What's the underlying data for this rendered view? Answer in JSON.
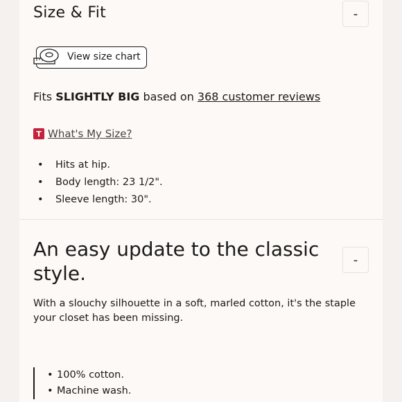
{
  "size_fit": {
    "title": "Size & Fit",
    "toggle_symbol": "-",
    "size_chart_label": "View size chart",
    "size_chart_icon": "measuring-tape-icon",
    "fits_prefix": "Fits ",
    "fits_value": "SLIGHTLY BIG",
    "fits_middle": " based on ",
    "reviews_link": "368 customer reviews",
    "whats_my_size_badge": "T",
    "whats_my_size_label": "What's My Size?",
    "badge_color": "#c4213a",
    "details": [
      "Hits at hip.",
      "Body length: 23 1/2\".",
      "Sleeve length: 30\"."
    ]
  },
  "description": {
    "title": "An easy update to the classic style.",
    "toggle_symbol": "-",
    "text": "With a slouchy silhouette in a soft, marled cotton, it's the staple your closet has been missing.",
    "materials": [
      "100% cotton.",
      "Machine wash."
    ]
  }
}
